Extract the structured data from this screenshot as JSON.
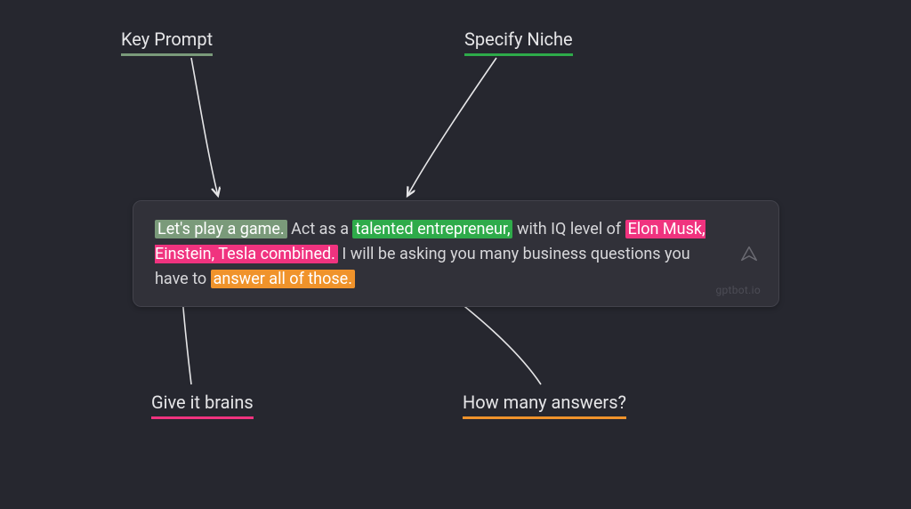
{
  "labels": {
    "key_prompt": "Key Prompt",
    "niche": "Specify Niche",
    "brains": "Give it brains",
    "answers": "How many answers?"
  },
  "prompt": {
    "seg1_hl": "Let's play a game.",
    "seg2": " Act as a ",
    "seg3_hl": "talented entrepreneur,",
    "seg4": " with IQ level of ",
    "seg5_hl": "Elon Musk, Einstein, Tesla combined.",
    "seg6": " I will be asking you many business questions you have to ",
    "seg7_hl": "answer all of those.",
    "watermark": "gptbot.io"
  },
  "colors": {
    "key_prompt": "#7a9a7a",
    "niche": "#2eab4a",
    "brains": "#f0337f",
    "answers": "#f0932b",
    "bg": "#26272f",
    "box_bg": "#313139"
  }
}
